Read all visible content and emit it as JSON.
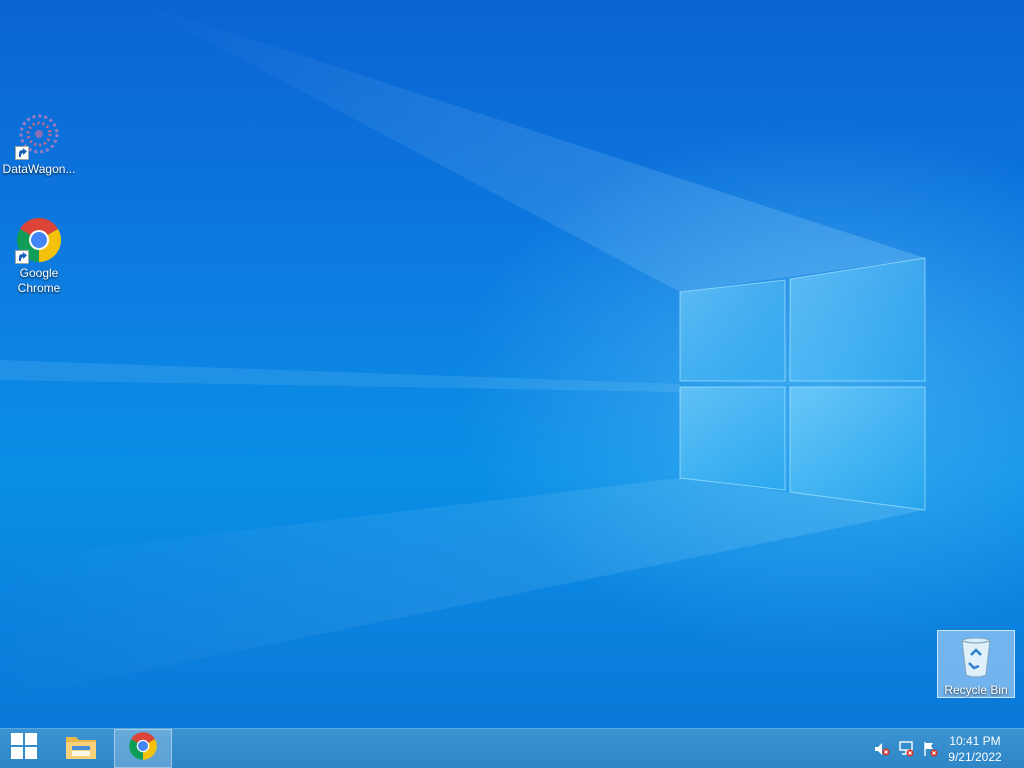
{
  "desktop": {
    "icons": [
      {
        "label": "DataWagon...",
        "icon": "datawagon-app-icon",
        "shortcut": true
      },
      {
        "label": "Google Chrome",
        "icon": "chrome-icon",
        "shortcut": true
      }
    ],
    "recycle_bin": {
      "label": "Recycle Bin",
      "icon": "recycle-bin-icon",
      "selected": true
    }
  },
  "taskbar": {
    "start": {
      "icon": "windows-logo-icon"
    },
    "pinned": [
      {
        "icon": "file-explorer-icon",
        "active": false
      },
      {
        "icon": "chrome-icon",
        "active": true
      }
    ],
    "tray": [
      {
        "icon": "volume-muted-icon"
      },
      {
        "icon": "network-disconnected-icon"
      },
      {
        "icon": "action-center-flag-icon"
      }
    ],
    "clock": {
      "time": "10:41 PM",
      "date": "9/21/2022"
    }
  },
  "colors": {
    "desktop_blue": "#0a78d8",
    "taskbar": "#2f86c7",
    "chrome_red": "#db4437",
    "chrome_yellow": "#f4c20d",
    "chrome_green": "#0f9d58",
    "chrome_blue": "#4285f4"
  }
}
